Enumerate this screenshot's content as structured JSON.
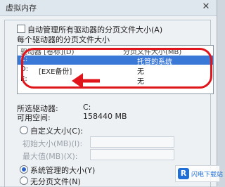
{
  "window": {
    "title": "虚拟内存",
    "close_glyph": "✕"
  },
  "auto_manage": {
    "label": "自动管理所有驱动器的分页文件大小(A)",
    "checked": false
  },
  "section_label": "每个驱动器的分页文件大小",
  "drive_list": {
    "columns": [
      "驱动器 [卷标](D)",
      "分页文件大小(MB)"
    ],
    "rows": [
      {
        "drive": "C:",
        "label": "",
        "size": "托管的系统"
      },
      {
        "drive": "D:",
        "label": "[EXE备份]",
        "size": "无"
      },
      {
        "drive": "E:",
        "label": "",
        "size": "无"
      }
    ],
    "selected_index": 0
  },
  "selected_drive": {
    "label": "所选驱动器:",
    "value": "C:"
  },
  "free_space": {
    "label": "可用空间:",
    "value": "158440 MB"
  },
  "options": {
    "custom_size": {
      "label": "自定义大小(C):",
      "checked": false
    },
    "initial_size": {
      "label": "初始大小(MB)(I):",
      "value": ""
    },
    "max_size": {
      "label": "最大值(MB)(X):",
      "value": ""
    },
    "system_managed": {
      "label": "系统管理的大小(Y)",
      "checked": true
    },
    "no_paging": {
      "label": "无分页文件(N)",
      "checked": false
    }
  },
  "annotation": {
    "color": "#e0141b"
  },
  "watermark": {
    "logo_glyph": "R",
    "text": "闪电下载站"
  }
}
